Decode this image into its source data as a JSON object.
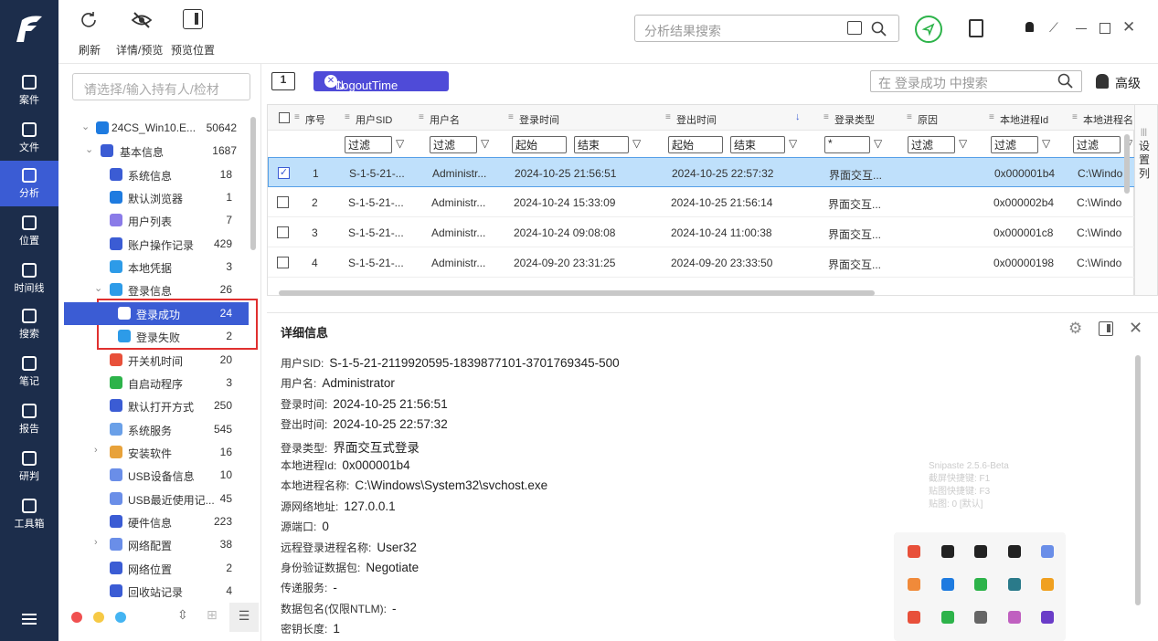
{
  "toolbar": {
    "refresh": "刷新",
    "details": "详情/预览",
    "preview_pos": "预览位置",
    "search_placeholder": "分析结果搜索"
  },
  "nav": [
    {
      "label": "案件",
      "icon": "case-icon"
    },
    {
      "label": "文件",
      "icon": "file-icon"
    },
    {
      "label": "分析",
      "icon": "analysis-icon"
    },
    {
      "label": "位置",
      "icon": "location-icon"
    },
    {
      "label": "时间线",
      "icon": "timeline-icon"
    },
    {
      "label": "搜索",
      "icon": "search-icon"
    },
    {
      "label": "笔记",
      "icon": "note-icon"
    },
    {
      "label": "报告",
      "icon": "report-icon"
    },
    {
      "label": "研判",
      "icon": "judge-icon"
    },
    {
      "label": "工具箱",
      "icon": "toolbox-icon"
    }
  ],
  "tree": {
    "search_placeholder": "请选择/输入持有人/检材",
    "items": [
      {
        "label": "24CS_Win10.E...",
        "count": "50642"
      },
      {
        "label": "基本信息",
        "count": "1687"
      },
      {
        "label": "系统信息",
        "count": "18"
      },
      {
        "label": "默认浏览器",
        "count": "1"
      },
      {
        "label": "用户列表",
        "count": "7"
      },
      {
        "label": "账户操作记录",
        "count": "429"
      },
      {
        "label": "本地凭据",
        "count": "3"
      },
      {
        "label": "登录信息",
        "count": "26"
      },
      {
        "label": "登录成功",
        "count": "24"
      },
      {
        "label": "登录失败",
        "count": "2"
      },
      {
        "label": "开关机时间",
        "count": "20"
      },
      {
        "label": "自启动程序",
        "count": "3"
      },
      {
        "label": "默认打开方式",
        "count": "250"
      },
      {
        "label": "系统服务",
        "count": "545"
      },
      {
        "label": "安装软件",
        "count": "16"
      },
      {
        "label": "USB设备信息",
        "count": "10"
      },
      {
        "label": "USB最近使用记...",
        "count": "45"
      },
      {
        "label": "硬件信息",
        "count": "223"
      },
      {
        "label": "网络配置",
        "count": "38"
      },
      {
        "label": "网络位置",
        "count": "2"
      },
      {
        "label": "回收站记录",
        "count": "4"
      }
    ]
  },
  "grid": {
    "page_num": "1",
    "sort_chip": "LogoutTime",
    "search_placeholder": "在 登录成功 中搜索",
    "advanced": "高级",
    "settings_col": "设置列",
    "headers": [
      "序号",
      "用户SID",
      "用户名",
      "登录时间",
      "登出时间",
      "登录类型",
      "原因",
      "本地进程Id",
      "本地进程名"
    ],
    "filters": {
      "filter": "过滤",
      "start": "起始",
      "end": "结束",
      "star": "*"
    },
    "rows": [
      {
        "n": "1",
        "sid": "S-1-5-21-...",
        "user": "Administr...",
        "login": "2024-10-25 21:56:51",
        "logout": "2024-10-25 22:57:32",
        "type": "界面交互...",
        "pid": "0x000001b4",
        "pname": "C:\\Windo"
      },
      {
        "n": "2",
        "sid": "S-1-5-21-...",
        "user": "Administr...",
        "login": "2024-10-24 15:33:09",
        "logout": "2024-10-25 21:56:14",
        "type": "界面交互...",
        "pid": "0x000002b4",
        "pname": "C:\\Windo"
      },
      {
        "n": "3",
        "sid": "S-1-5-21-...",
        "user": "Administr...",
        "login": "2024-10-24 09:08:08",
        "logout": "2024-10-24 11:00:38",
        "type": "界面交互...",
        "pid": "0x000001c8",
        "pname": "C:\\Windo"
      },
      {
        "n": "4",
        "sid": "S-1-5-21-...",
        "user": "Administr...",
        "login": "2024-09-20 23:31:25",
        "logout": "2024-09-20 23:33:50",
        "type": "界面交互...",
        "pid": "0x00000198",
        "pname": "C:\\Windo"
      }
    ]
  },
  "detail": {
    "title": "详细信息",
    "fields": [
      {
        "k": "用户SID:",
        "v": "S-1-5-21-2119920595-1839877101-3701769345-500"
      },
      {
        "k": "用户名:",
        "v": "Administrator"
      },
      {
        "k": "登录时间:",
        "v": "2024-10-25 21:56:51"
      },
      {
        "k": "登出时间:",
        "v": "2024-10-25 22:57:32"
      },
      {
        "k": "登录类型:",
        "v": "界面交互式登录"
      },
      {
        "k": "本地进程Id:",
        "v": "0x000001b4"
      },
      {
        "k": "本地进程名称:",
        "v": "C:\\Windows\\System32\\svchost.exe"
      },
      {
        "k": "源网络地址:",
        "v": "127.0.0.1"
      },
      {
        "k": "源端口:",
        "v": "0"
      },
      {
        "k": "远程登录进程名称:",
        "v": "User32"
      },
      {
        "k": "身份验证数据包:",
        "v": "Negotiate"
      },
      {
        "k": "传递服务:",
        "v": "-"
      },
      {
        "k": "数据包名(仅限NTLM):",
        "v": "-"
      },
      {
        "k": "密钥长度:",
        "v": "1"
      }
    ]
  },
  "snipaste": {
    "l1": "Snipaste 2.5.6-Beta",
    "l2": "截屏快捷键: F1",
    "l3": "贴图快捷键: F3",
    "l4": "贴图: 0 [默认]"
  },
  "colors": {
    "nav_bg": "#1c2d4b",
    "accent": "#3b5cd4",
    "chip": "#4f4bd8",
    "highlight": "#e0302f",
    "row_sel": "#bfe0fb"
  }
}
